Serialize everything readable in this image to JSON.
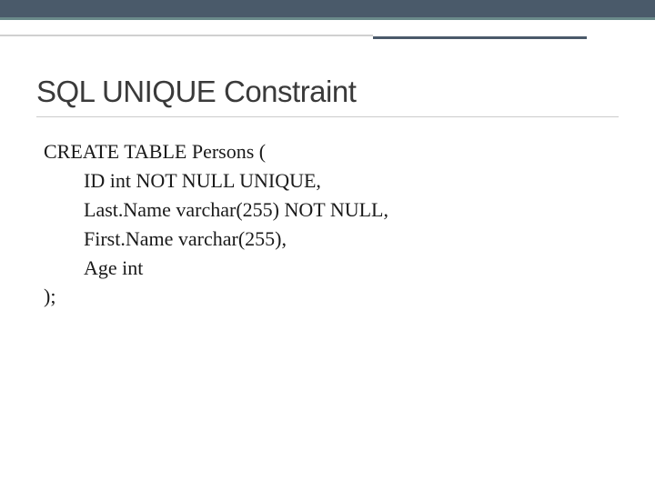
{
  "slide": {
    "title": "SQL UNIQUE Constraint",
    "code": {
      "line1": "CREATE TABLE Persons (",
      "line2": "ID int NOT NULL UNIQUE,",
      "line3": "Last.Name varchar(255) NOT NULL,",
      "line4": "First.Name varchar(255),",
      "line5": "Age int",
      "line6": ");"
    }
  }
}
